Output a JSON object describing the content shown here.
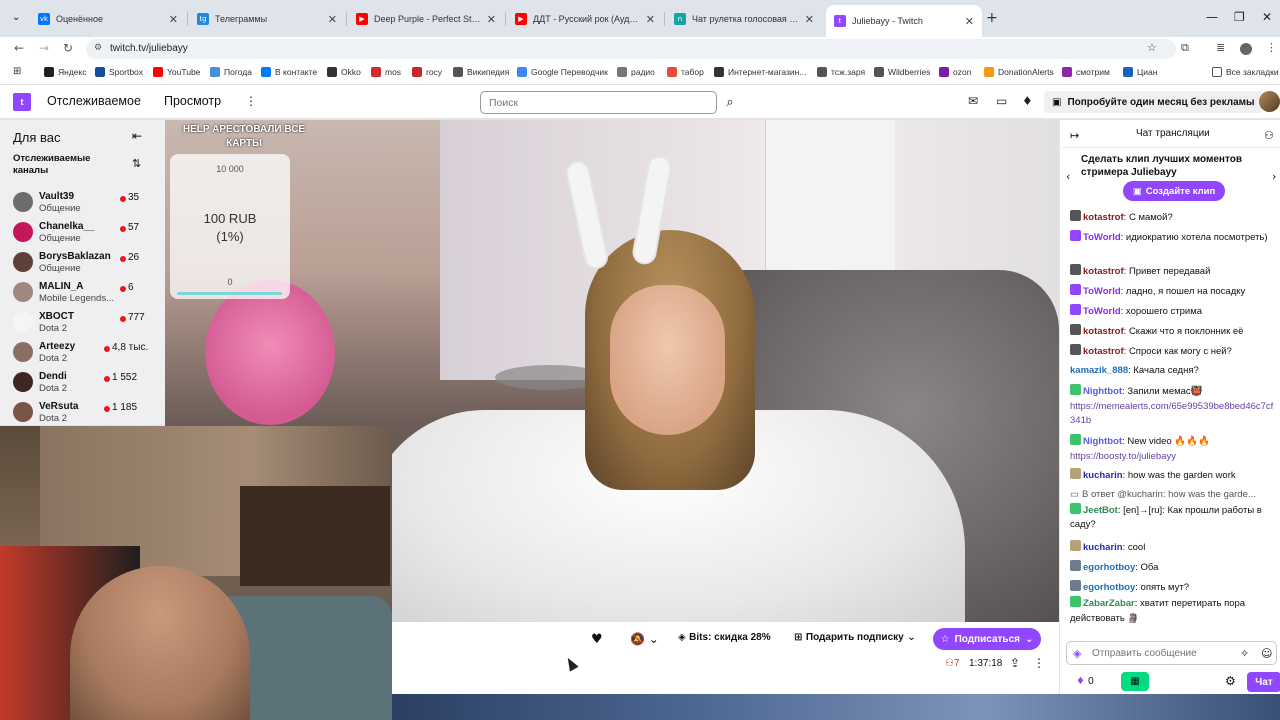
{
  "browser": {
    "tabs": [
      {
        "title": "Оценённое",
        "color": "#0077ff",
        "glyph": "vk"
      },
      {
        "title": "Телеграммы",
        "color": "#1e88e5",
        "glyph": "tg"
      },
      {
        "title": "Deep Purple - Perfect Strangers",
        "color": "#ff0000",
        "glyph": "▶"
      },
      {
        "title": "ДДТ - Русский рок (Аудио) - YouTube",
        "color": "#ff0000",
        "glyph": "▶"
      },
      {
        "title": "Чат рулетка голосовая — Nekto",
        "color": "#1aa3a3",
        "glyph": "n"
      },
      {
        "title": "Juliebayy - Twitch",
        "color": "#9146ff",
        "glyph": "t"
      }
    ],
    "new_tab": "+",
    "window_controls": [
      "—",
      "❐",
      "✕"
    ],
    "url": "twitch.tv/juliebayy",
    "bookmarks": [
      {
        "label": "Яндекс",
        "color": "#222"
      },
      {
        "label": "Sportbox",
        "color": "#1a4a9c"
      },
      {
        "label": "YouTube",
        "color": "#ff0000"
      },
      {
        "label": "Погода",
        "color": "#4a90e2"
      },
      {
        "label": "В контакте",
        "color": "#0077ff"
      },
      {
        "label": "Okko",
        "color": "#333"
      },
      {
        "label": "mos",
        "color": "#d32f2f"
      },
      {
        "label": "rocy",
        "color": "#c62828"
      },
      {
        "label": "Википедия",
        "color": "#555"
      },
      {
        "label": "Google Переводчик",
        "color": "#4285f4"
      },
      {
        "label": "радио",
        "color": "#777"
      },
      {
        "label": "табор",
        "color": "#e74c3c"
      },
      {
        "label": "Интернет-магазин...",
        "color": "#333"
      },
      {
        "label": "тсж.заря",
        "color": "#555"
      },
      {
        "label": "Wildberries",
        "color": "#555"
      },
      {
        "label": "ozon",
        "color": "#7b1fa2"
      },
      {
        "label": "DonationAlerts",
        "color": "#f39c12"
      },
      {
        "label": "смотрим",
        "color": "#8e24aa"
      },
      {
        "label": "Циан",
        "color": "#1565c0"
      }
    ],
    "all_bookmarks": "Все закладки"
  },
  "twitch": {
    "nav": {
      "following": "Отслеживаемое",
      "browse": "Просмотр"
    },
    "search_placeholder": "Поиск",
    "promo": "Попробуйте один месяц без рекламы"
  },
  "sidebar": {
    "title": "Для вас",
    "followed": "Отслеживаемые каналы",
    "channels": [
      {
        "name": "Vault39",
        "game": "Общение",
        "viewers": "35",
        "avatar": "#6d6d6d"
      },
      {
        "name": "Chanelka__",
        "game": "Общение",
        "viewers": "57",
        "avatar": "#c2185b"
      },
      {
        "name": "BorysBaklazan",
        "game": "Общение",
        "viewers": "26",
        "avatar": "#5d4037"
      },
      {
        "name": "MALIN_A",
        "game": "Mobile Legends...",
        "viewers": "6",
        "avatar": "#a1887f"
      },
      {
        "name": "XBOCT",
        "game": "Dota 2",
        "viewers": "777",
        "avatar": "#f5f5f5"
      },
      {
        "name": "Arteezy",
        "game": "Dota 2",
        "viewers": "4,8 тыс.",
        "avatar": "#8d6e63"
      },
      {
        "name": "Dendi",
        "game": "Dota 2",
        "viewers": "1 552",
        "avatar": "#3e2723"
      },
      {
        "name": "VeRsuta",
        "game": "Dota 2",
        "viewers": "1 185",
        "avatar": "#795548"
      }
    ]
  },
  "stream_overlay": {
    "title": "HELP АРЕСТОВАЛИ ВСЕ КАРТЫ",
    "goal_top": "10 000",
    "goal_value": "100 RUB\n(1%)",
    "goal_bottom": "0"
  },
  "video_bar": {
    "bits": "Bits: скидка 28%",
    "gift": "Подарить подписку",
    "subscribe": "Подписаться",
    "viewers": "7",
    "uptime": "1:37:18"
  },
  "chat": {
    "title": "Чат трансляции",
    "clip_text": "Сделать клип лучших моментов стримера Juliebayy",
    "clip_button": "Создайте клип",
    "messages": [
      {
        "user": "kotastrof",
        "color": "#8b1a1a",
        "badge": "#555",
        "text": "С мамой?"
      },
      {
        "user": "ToWorld",
        "color": "#8a2be2",
        "badge": "#9146ff",
        "text": "идиократию хотела посмотреть)"
      },
      {
        "user": "kotastrof",
        "color": "#8b1a1a",
        "badge": "#555",
        "text": "Привет передавай"
      },
      {
        "user": "ToWorld",
        "color": "#8a2be2",
        "badge": "#9146ff",
        "text": "ладно, я пошел на посадку"
      },
      {
        "user": "ToWorld",
        "color": "#8a2be2",
        "badge": "#9146ff",
        "text": "хорошего стрима"
      },
      {
        "user": "kotastrof",
        "color": "#8b1a1a",
        "badge": "#555",
        "text": "Скажи что я поклонник её"
      },
      {
        "user": "kotastrof",
        "color": "#8b1a1a",
        "badge": "#555",
        "text": "Спроси как могу с ней?"
      },
      {
        "user": "kamazik_888",
        "color": "#1e6fb8",
        "badge": "",
        "text": "Качала седня?"
      },
      {
        "user": "Nightbot",
        "color": "#5a5adf",
        "badge": "#3cc46a",
        "text": "Запили мемас👹",
        "link": "https://memealerts.com/65e99539be8bed46c7cf341b"
      },
      {
        "user": "Nightbot",
        "color": "#5a5adf",
        "badge": "#3cc46a",
        "text": "New video 🔥🔥🔥",
        "link": "https://boosty.to/juliebayy"
      },
      {
        "user": "kucharin",
        "color": "#2a2aa8",
        "badge": "#b5a27a",
        "text": "how was the garden work"
      },
      {
        "reply": "В ответ @kucharin: how was the garde...",
        "user": "JeetBot",
        "color": "#2e8b57",
        "badge": "#3cc46a",
        "text": "[en]→[ru]: Как прошли работы в саду?"
      },
      {
        "user": "kucharin",
        "color": "#2a2aa8",
        "badge": "#b5a27a",
        "text": "cool"
      },
      {
        "user": "egorhotboy",
        "color": "#1e6fb8",
        "badge": "#6d7b8d",
        "text": "Оба"
      },
      {
        "user": "egorhotboy",
        "color": "#1e6fb8",
        "badge": "#6d7b8d",
        "text": "опять мут?"
      },
      {
        "user": "ZabarZabar",
        "color": "#2e8b57",
        "badge": "#3cc46a",
        "text": "хватит перетирать пора действовать 🗿"
      }
    ],
    "input_placeholder": "Отправить сообщение",
    "points": "0",
    "send_button": "Чат"
  }
}
